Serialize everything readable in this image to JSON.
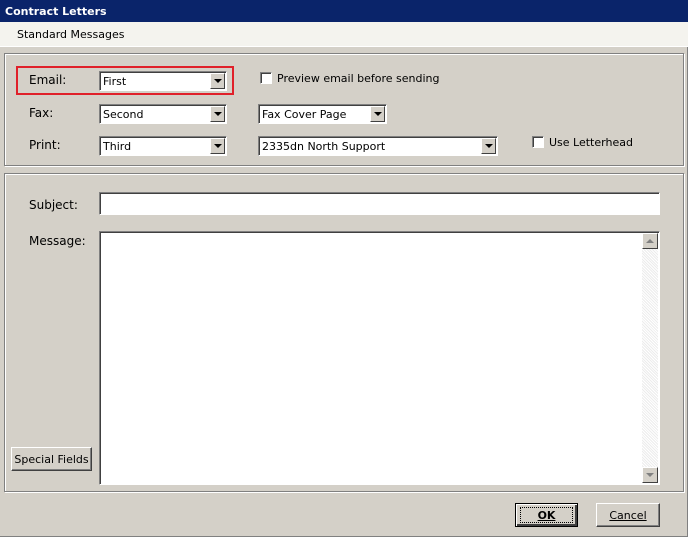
{
  "window": {
    "title": "Contract Letters"
  },
  "menu": {
    "items": [
      "Standard Messages"
    ]
  },
  "delivery": {
    "email": {
      "label": "Email:",
      "value": "First"
    },
    "fax": {
      "label": "Fax:",
      "value": "Second",
      "template": "Fax Cover Page"
    },
    "print": {
      "label": "Print:",
      "value": "Third",
      "printer": "2335dn North Support"
    },
    "preview_email": {
      "label": "Preview email before sending",
      "checked": false
    },
    "use_letterhead": {
      "label": "Use Letterhead",
      "checked": false
    }
  },
  "message": {
    "subject_label": "Subject:",
    "subject_value": "",
    "message_label": "Message:",
    "message_value": "",
    "special_fields_label": "Special Fields"
  },
  "buttons": {
    "ok": "OK",
    "cancel": "Cancel"
  },
  "colors": {
    "titlebar": "#0a246a",
    "face": "#d4d0c8",
    "highlight": "#e0202a"
  }
}
